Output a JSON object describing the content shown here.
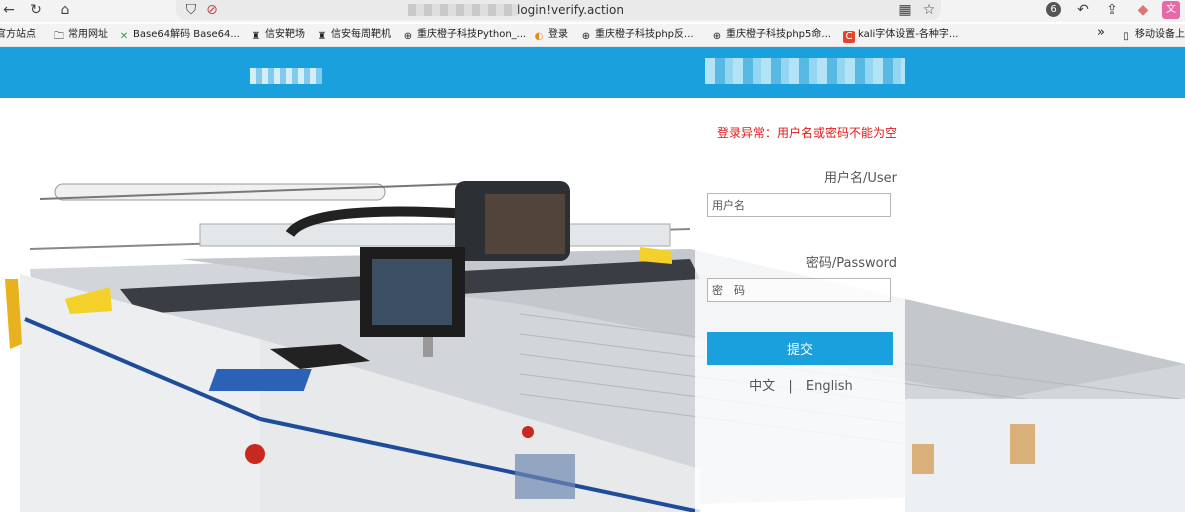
{
  "browser": {
    "url": "login!verify.action",
    "tab_badge_count": "6",
    "toolbar_icons": [
      "back-arrow-icon",
      "refresh-icon",
      "home-icon",
      "shield-icon",
      "lock-warning-icon",
      "qr-code-icon",
      "star-icon",
      "profile-icon",
      "undo-icon",
      "share-icon",
      "extension-icon",
      "translate-icon"
    ]
  },
  "bookmarks": {
    "items": [
      {
        "label": "官方站点",
        "icon": "bookmark-icon"
      },
      {
        "label": "常用网址",
        "icon": "folder-icon"
      },
      {
        "label": "Base64解码 Base64...",
        "icon": "base64-icon"
      },
      {
        "label": "信安靶场",
        "icon": "target-icon"
      },
      {
        "label": "信安每周靶机",
        "icon": "target-icon"
      },
      {
        "label": "重庆橙子科技Python_...",
        "icon": "globe-icon"
      },
      {
        "label": "登录",
        "icon": "login-icon"
      },
      {
        "label": "重庆橙子科技php反...",
        "icon": "globe-icon"
      },
      {
        "label": "重庆橙子科技php5命...",
        "icon": "globe-icon"
      },
      {
        "label": "kali字体设置-各种字...",
        "icon": "c-icon"
      },
      {
        "label": "移动设备上的",
        "icon": "mobile-icon"
      }
    ],
    "more": "»"
  },
  "login": {
    "error_message": "登录异常：用户名或密码不能为空",
    "username_label": "用户名/User",
    "username_placeholder": "用户名",
    "password_label": "密码/Password",
    "password_placeholder": "密　码",
    "submit_label": "提交",
    "lang_zh": "中文",
    "lang_separator": "|",
    "lang_en": "English"
  },
  "colors": {
    "header_blue": "#1aa0dc",
    "button_blue": "#1aa0dc",
    "error_red": "#e21a1a"
  }
}
